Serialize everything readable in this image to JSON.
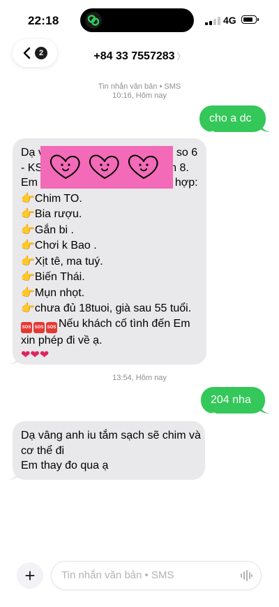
{
  "status_bar": {
    "time": "22:18",
    "network": "4G",
    "signal_bars": 2
  },
  "header": {
    "back_badge": "2",
    "contact": "+84 33 7557283"
  },
  "meta": {
    "sms_label": "Tin nhắn văn bản • SMS",
    "time1": "10:16, Hôm nay",
    "time2": "13:54, Hôm nay"
  },
  "messages": {
    "out1": "cho a dc e",
    "in1": {
      "l1": "Dạ v",
      "l1b": "so 6",
      "l2": "- KS",
      "l2b": "n 8.",
      "l3": "Em t",
      "l3b": "hợp:",
      "items": [
        "Chim TO.",
        "Bia rượu.",
        "Gắn bi .",
        "Chơi k Bao .",
        "Xịt tê, ma tuý.",
        "Biến Thái.",
        "Mụn nhọt.",
        "chưa đủ 18tuoi, già sau 55 tuổi."
      ],
      "sos_text": "Nếu khách cố tình đến Em",
      "sos_text2": "xin phép đi về ạ.",
      "hearts": "❤❤❤"
    },
    "out2": "204 nha e",
    "in2": {
      "l1": "Dạ vâng anh iu tắm sạch sẽ chim và",
      "l2": "cơ thể đi",
      "l3": "Em thay đo qua ạ"
    }
  },
  "compose": {
    "placeholder": "Tin nhắn văn bản • SMS"
  },
  "colors": {
    "outgoing": "#34c759",
    "incoming": "#e9e9eb",
    "sticker": "#f36ab8"
  },
  "icons": [
    "back-chevron-icon",
    "link-icon",
    "plus-icon",
    "waveform-icon",
    "pointing-hand-icon",
    "sos-icon",
    "heart-icon"
  ]
}
